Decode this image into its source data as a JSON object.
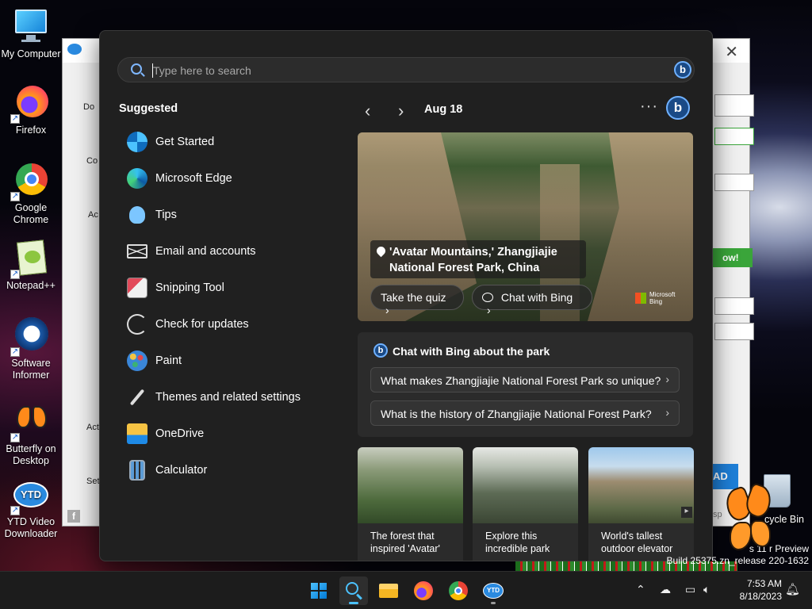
{
  "desktop": {
    "icons": [
      {
        "label": "My Computer",
        "icon": "monitor-icon"
      },
      {
        "label": "Firefox",
        "icon": "firefox-icon"
      },
      {
        "label": "Google Chrome",
        "icon": "chrome-icon"
      },
      {
        "label": "Notepad++",
        "icon": "notepadpp-icon"
      },
      {
        "label": "Software Informer",
        "icon": "software-informer-icon"
      },
      {
        "label": "Butterfly on Desktop",
        "icon": "butterfly-icon"
      },
      {
        "label": "YTD Video Downloader",
        "icon": "ytd-icon"
      },
      {
        "label": "Recycle Bin",
        "icon": "recycle-bin-icon"
      }
    ],
    "recycle_label_visible": "cycle Bin",
    "preview_text_1": "s 11   r Preview",
    "preview_text_2": "Build 25375.zn_release   220-1632"
  },
  "background_window": {
    "green_button": "ow!",
    "blue_button": "AD",
    "fragments": [
      "Do",
      "Co",
      "Ac",
      "Act",
      "Set",
      "sp"
    ]
  },
  "search": {
    "placeholder": "Type here to search"
  },
  "suggested": {
    "title": "Suggested",
    "items": [
      {
        "label": "Get Started",
        "icon": "get-started-icon"
      },
      {
        "label": "Microsoft Edge",
        "icon": "edge-icon"
      },
      {
        "label": "Tips",
        "icon": "tips-icon"
      },
      {
        "label": "Email and accounts",
        "icon": "mail-icon"
      },
      {
        "label": "Snipping Tool",
        "icon": "snipping-tool-icon"
      },
      {
        "label": "Check for updates",
        "icon": "update-icon"
      },
      {
        "label": "Paint",
        "icon": "paint-icon"
      },
      {
        "label": "Themes and related settings",
        "icon": "brush-icon"
      },
      {
        "label": "OneDrive",
        "icon": "onedrive-icon"
      },
      {
        "label": "Calculator",
        "icon": "calculator-icon"
      }
    ]
  },
  "highlights": {
    "date": "Aug 18",
    "more": "···",
    "hero": {
      "caption_line1": "'Avatar Mountains,' Zhangjiajie",
      "caption_line2": "National Forest Park, China",
      "quiz_button": "Take the quiz",
      "chat_button": "Chat with Bing",
      "brand_line1": "Microsoft",
      "brand_line2": "Bing"
    },
    "chat": {
      "title": "Chat with Bing about the park",
      "questions": [
        "What makes Zhangjiajie National Forest Park so unique?",
        "What is the history of Zhangjiajie National Forest Park?"
      ]
    },
    "cards": [
      {
        "line1": "The forest that",
        "line2": "inspired 'Avatar'"
      },
      {
        "line1": "Explore this",
        "line2": "incredible park"
      },
      {
        "line1": "World's tallest",
        "line2": "outdoor elevator"
      }
    ]
  },
  "taskbar": {
    "apps": [
      "windows-start-icon",
      "search-icon",
      "file-explorer-icon",
      "firefox-icon",
      "chrome-icon",
      "ytd-icon"
    ],
    "time": "7:53 AM",
    "date": "8/18/2023"
  }
}
